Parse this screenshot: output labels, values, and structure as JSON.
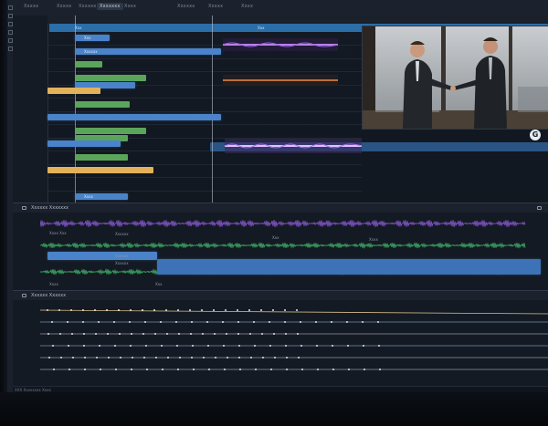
{
  "toolbar": {
    "tabs": [
      "Xxxxx",
      "Xxxxx",
      "Xxxxxx",
      "Xxxxxxx",
      "Xxxx",
      "Xxxxxx",
      "Xxxxx",
      "Xxxx"
    ],
    "active_index": 3
  },
  "ruler": {
    "markers": [
      "Xxx",
      "Xxx"
    ]
  },
  "video_tracks": {
    "clips": [
      {
        "label": "Xxx"
      },
      {
        "label": "Xxxxxx"
      },
      {
        "label": ""
      },
      {
        "label": ""
      },
      {
        "label": ""
      },
      {
        "label": ""
      },
      {
        "label": ""
      },
      {
        "label": ""
      },
      {
        "label": ""
      },
      {
        "label": ""
      },
      {
        "label": ""
      },
      {
        "label": ""
      },
      {
        "label": ""
      },
      {
        "label": "Xxxx"
      }
    ]
  },
  "preview": {
    "badge": "G",
    "description_icon": "handshake-video-frame"
  },
  "audio_panel": {
    "title": "Xxxxxx Xxxxxxx",
    "row_labels": [
      "Xxxx Xxx",
      "Xxxxxx",
      "Xxx",
      "Xxxx",
      "Xxxxxx",
      "Xxxxxx",
      "Xxx",
      "Xxxx"
    ],
    "sub_labels": [
      "Xxxx Xxx",
      "Xxxxxx",
      "Xxxxxx"
    ]
  },
  "effects_panel": {
    "title": "Xxxxxx Xxxxxx"
  },
  "status": {
    "text": "XXX Xxxxxxxx Xxxx"
  },
  "colors": {
    "accent_blue": "#4a83c9",
    "clip_green": "#5aa55a",
    "clip_yellow": "#e2b25a",
    "wave_purple": "#8a5ad6",
    "wave_green": "#3fb46a"
  }
}
